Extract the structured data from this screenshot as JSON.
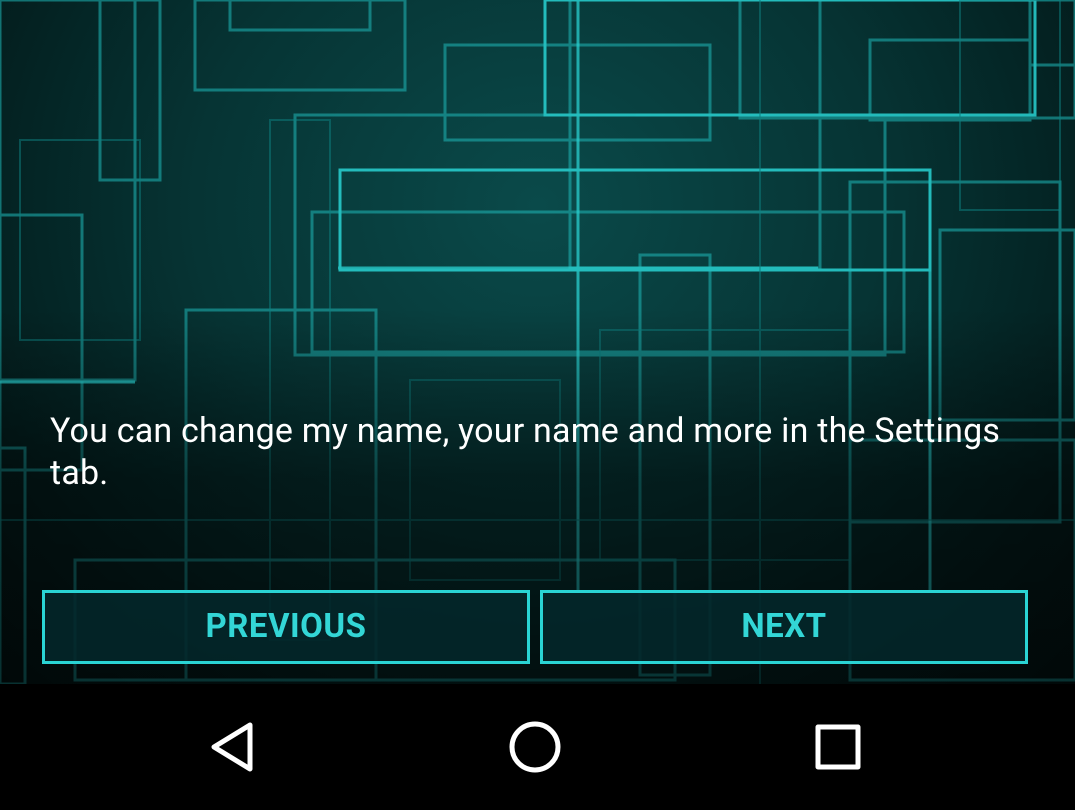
{
  "onboarding": {
    "message": "You can change my name, your name and more in the Settings tab.",
    "previous_label": "PREVIOUS",
    "next_label": "NEXT"
  },
  "colors": {
    "accent": "#2ad4d4",
    "button_text": "#33d6d6",
    "background": "#063434",
    "navbar": "#000000",
    "message_text": "#ffffff"
  },
  "navbar": {
    "back_icon": "back-triangle-icon",
    "home_icon": "home-circle-icon",
    "recent_icon": "recent-apps-square-icon"
  }
}
